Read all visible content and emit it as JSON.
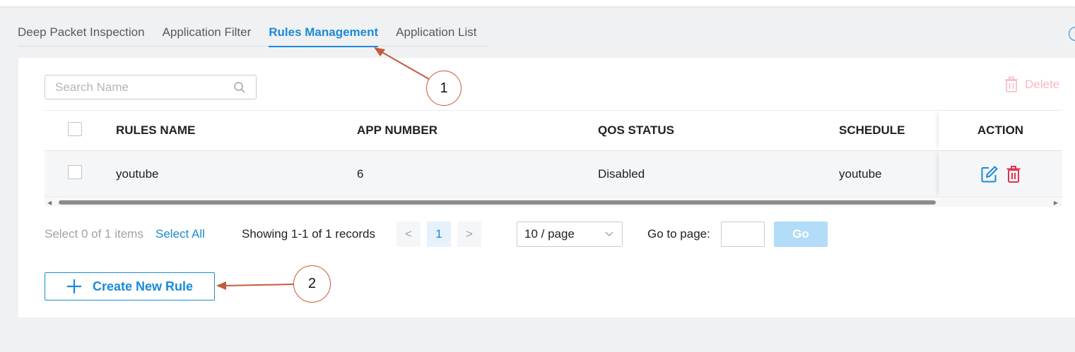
{
  "tabs": [
    {
      "label": "Deep Packet Inspection",
      "active": false
    },
    {
      "label": "Application Filter",
      "active": false
    },
    {
      "label": "Rules Management",
      "active": true
    },
    {
      "label": "Application List",
      "active": false
    }
  ],
  "search": {
    "placeholder": "Search Name",
    "value": ""
  },
  "toolbar": {
    "delete_label": "Delete"
  },
  "table": {
    "columns": [
      "RULES NAME",
      "APP NUMBER",
      "QOS STATUS",
      "SCHEDULE",
      "ACTION"
    ],
    "rows": [
      {
        "rules_name": "youtube",
        "app_number": "6",
        "qos_status": "Disabled",
        "schedule": "youtube"
      }
    ]
  },
  "pagination": {
    "selection_text": "Select 0 of 1 items",
    "select_all_label": "Select All",
    "showing_text": "Showing 1-1 of 1 records",
    "prev_icon": "<",
    "current_page": "1",
    "next_icon": ">",
    "page_size": "10 / page",
    "goto_label": "Go to page:",
    "goto_value": "",
    "go_label": "Go"
  },
  "create_button": {
    "label": "Create New Rule"
  },
  "annotations": [
    {
      "number": "1"
    },
    {
      "number": "2"
    }
  ],
  "colors": {
    "accent": "#1a8ad8",
    "delete_disabled": "#f6b8c4",
    "delete_icon": "#e0314f",
    "annotation": "#c45a3b"
  },
  "icons": {
    "search": "search-icon",
    "delete": "trash-icon",
    "edit": "edit-icon",
    "create": "plus-icon",
    "page_size": "chevron-down-icon"
  }
}
